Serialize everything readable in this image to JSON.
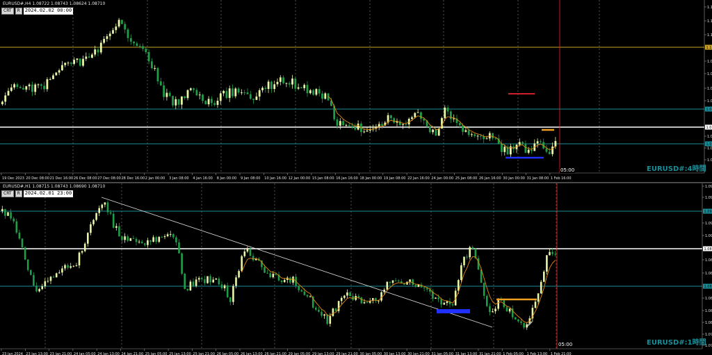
{
  "colors": {
    "background": "#000000",
    "bull": "#e8f5a6",
    "bear": "#1f9d49",
    "grid": "#888888",
    "teal_level": "#1a8e98",
    "gold_level": "#c9a227",
    "white_level": "#ffffff",
    "red_cursor": "#ff2020",
    "ma": "#e08a10"
  },
  "top": {
    "header": "EURUSD#,H4  1.08722 1.08743 1.08624 1.08710",
    "tags": [
      "CRT",
      "R"
    ],
    "time_box": "2024.02.02 00:00",
    "watermark": "EURUSD#:4時間",
    "now_label": "05:00",
    "price_labels": [
      "1.1",
      "1.1",
      "1.1",
      "1.0",
      "1.0",
      "1.0",
      "1.0",
      "1.0",
      "1.0",
      "1.0"
    ],
    "boxed_price_labels": [
      "1.1",
      "1.0",
      "1.0",
      "1.0"
    ],
    "dates": [
      "19 Dec 2023",
      "20 Dec 08:00",
      "21 Dec 16:00",
      "26 Dec 08:00",
      "27 Dec 08:00",
      "28 Dec 16:00",
      "2 Jan 00:00",
      "3 Jan 08:00",
      "4 Jan 16:00",
      "8 Jan 00:00",
      "9 Jan 08:00",
      "10 Jan 16:00",
      "12 Jan 00:00",
      "15 Jan 08:00",
      "16 Jan 16:00",
      "18 Jan 00:00",
      "19 Jan 08:00",
      "22 Jan 16:00",
      "24 Jan 00:00",
      "25 Jan 08:00",
      "26 Jan 16:00",
      "30 Jan 00:00",
      "31 Jan 08:00",
      "1 Feb 16:00"
    ]
  },
  "bottom": {
    "header": "EURUSD#,H1  1.08715 1.08743 1.08690 1.08710",
    "tags": [
      "CRT",
      "R"
    ],
    "time_box": "2024.02.01 23:00",
    "watermark": "EURUSD#:1時間",
    "now_label": "05:00",
    "price_labels": [
      "1.09",
      "1.09",
      "1.09",
      "1.09",
      "1.08",
      "1.08",
      "1.08",
      "1.08",
      "1.08",
      "1.07",
      "1.07"
    ],
    "boxed_price_labels": [
      "1.09",
      "1.08",
      "1.08"
    ],
    "dates": [
      "23 Jan 2024",
      "23 Jan 13:00",
      "23 Jan 21:00",
      "24 Jan 05:00",
      "24 Jan 13:00",
      "24 Jan 21:00",
      "25 Jan 05:00",
      "25 Jan 13:00",
      "25 Jan 21:00",
      "26 Jan 05:00",
      "26 Jan 13:00",
      "26 Jan 21:00",
      "29 Jan 05:00",
      "29 Jan 13:00",
      "29 Jan 21:00",
      "30 Jan 05:00",
      "30 Jan 13:00",
      "30 Jan 21:00",
      "31 Jan 05:00",
      "31 Jan 13:00",
      "31 Jan 21:00",
      "1 Feb 05:00",
      "1 Feb 13:00",
      "1 Feb 21:00"
    ]
  }
}
